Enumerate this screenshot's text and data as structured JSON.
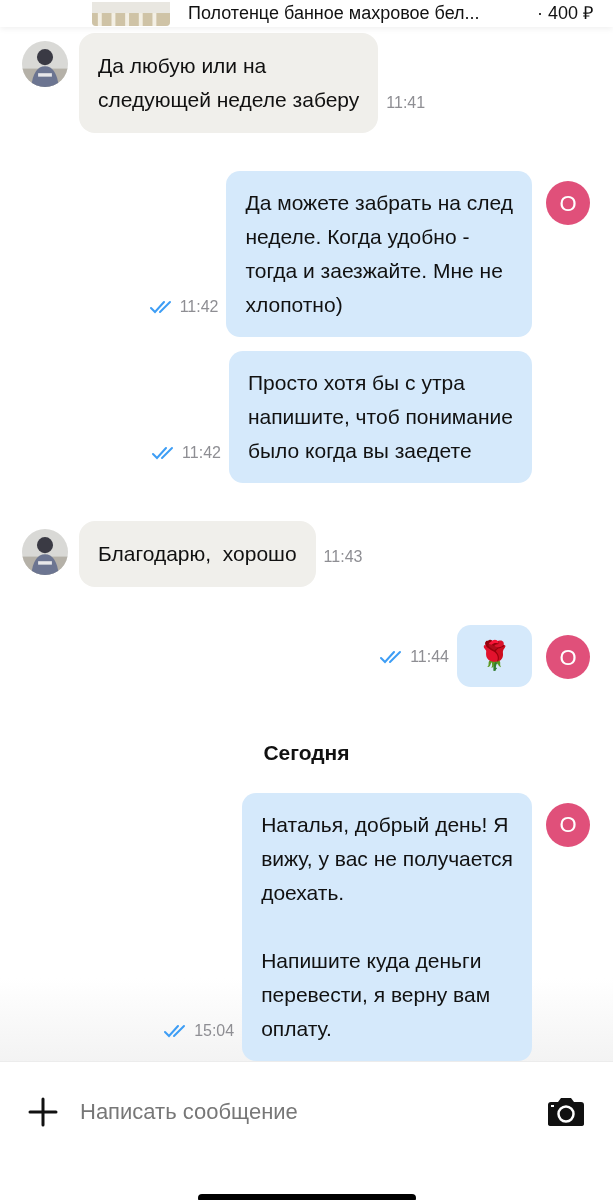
{
  "header": {
    "product": {
      "kind": "picture",
      "title": "Полотенце банное махровое бел...",
      "price": "· 400 ₽"
    }
  },
  "messages": [
    {
      "kind": "incoming",
      "text": "Да любую или на\nследующей неделе заберу",
      "time": "11:41"
    },
    {
      "kind": "outgoing",
      "text": "Да можете забрать на след\nнеделе. Когда удобно -\nтогда и заезжайте. Мне не\nхлопотно)",
      "time": "11:42",
      "read": true,
      "avatar": {
        "letter": "О",
        "color": "#e0507a"
      }
    },
    {
      "kind": "outgoing",
      "text": "Просто хотя бы с утра\nнапишите, чтоб понимание\nбыло когда вы заедете",
      "time": "11:42",
      "read": true
    },
    {
      "kind": "incoming",
      "text": "Благодарю,  хорошо",
      "time": "11:43"
    },
    {
      "kind": "outgoing",
      "text": "🌹",
      "time": "11:44",
      "read": true,
      "avatar": {
        "letter": "О",
        "color": "#e0507a"
      }
    },
    {
      "kind": "date",
      "text": "Сегодня"
    },
    {
      "kind": "outgoing",
      "text": "Наталья, добрый день! Я\nвижу, у вас не получается\nдоехать.\n\nНапишите куда деньги\nперевести, я верну вам\nоплату.",
      "time": "15:04",
      "read": true,
      "avatar": {
        "letter": "О",
        "color": "#e0507a"
      }
    }
  ],
  "composer": {
    "placeholder": "Написать сообщение"
  }
}
